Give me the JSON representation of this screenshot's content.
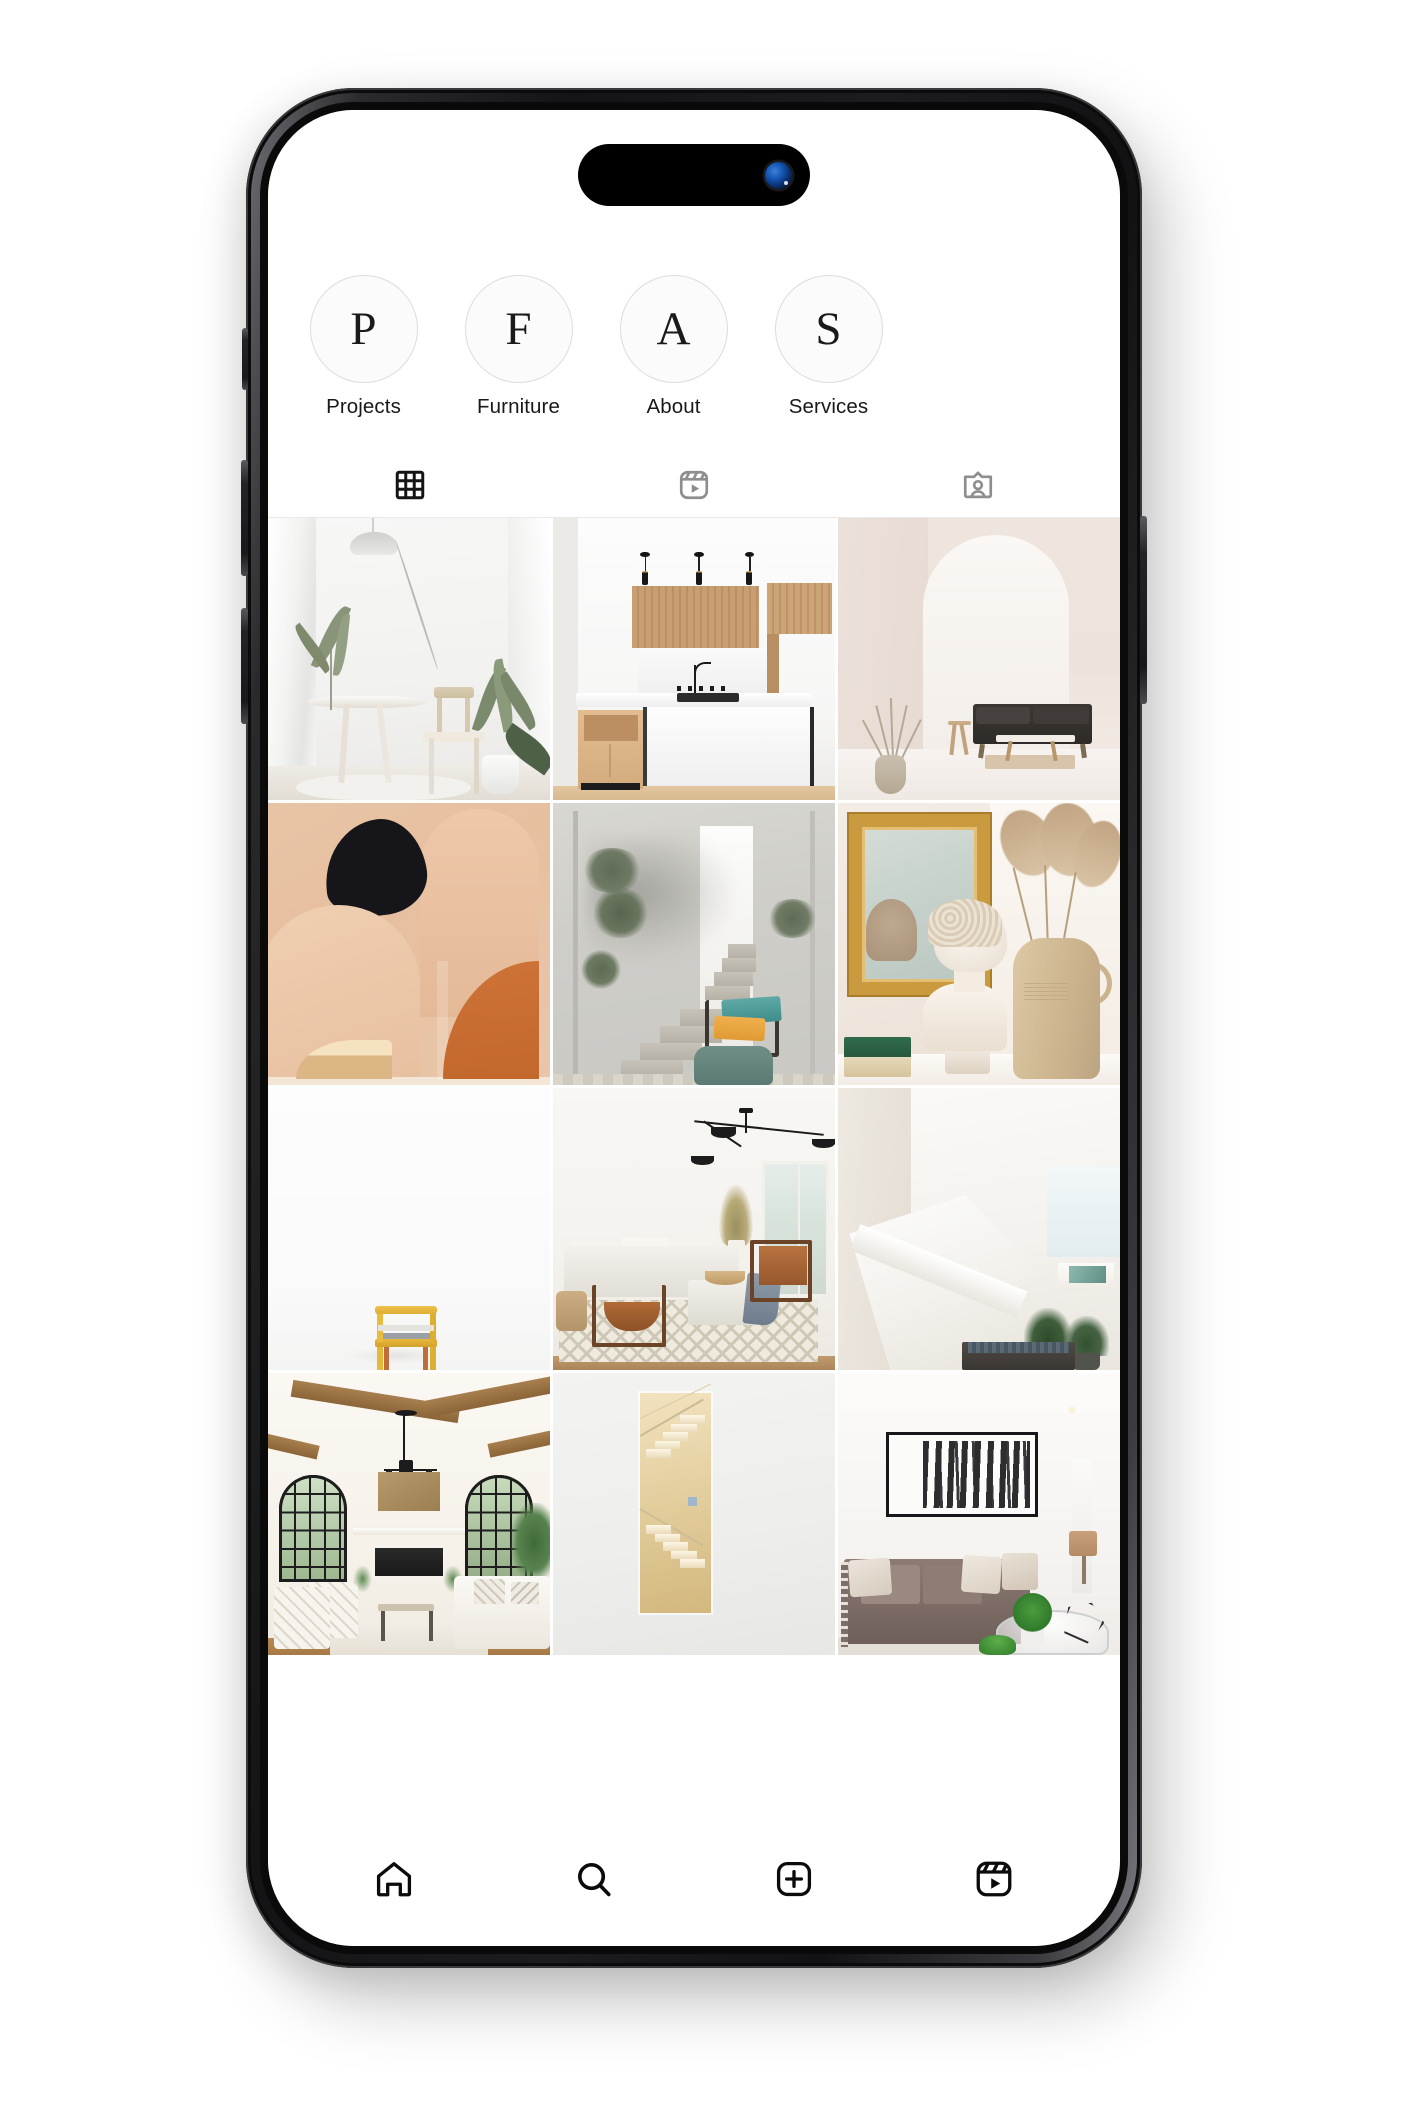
{
  "app": {
    "name": "instagram-profile",
    "device": "smartphone-mockup"
  },
  "status_bar": {
    "island_label": "Dynamic Island",
    "camera_icon": "camera-lens-icon"
  },
  "highlights": {
    "items": [
      {
        "letter": "P",
        "label": "Projects"
      },
      {
        "letter": "F",
        "label": "Furniture"
      },
      {
        "letter": "A",
        "label": "About"
      },
      {
        "letter": "S",
        "label": "Services"
      }
    ]
  },
  "profile_tabs": {
    "items": [
      {
        "icon": "grid-icon",
        "name": "posts-tab",
        "active": true
      },
      {
        "icon": "reels-icon",
        "name": "reels-tab",
        "active": false
      },
      {
        "icon": "tagged-icon",
        "name": "tagged-tab",
        "active": false
      }
    ],
    "active_color": "#141414",
    "inactive_color": "#8e8e8e"
  },
  "grid": {
    "columns": 3,
    "posts": [
      {
        "id": 1,
        "alt": "Bright white dining nook with round table, wooden chair and palm plants"
      },
      {
        "id": 2,
        "alt": "Modern kitchen with wood upper cabinets, white island and black pendant lights"
      },
      {
        "id": 3,
        "alt": "Beige arched room with dark sofa, low table and a vase of dried grass"
      },
      {
        "id": 4,
        "alt": "Abstract tan arch composition with black blob and terracotta quarter circle"
      },
      {
        "id": 5,
        "alt": "Grey staircase with olive tree shadows, teal and gold cushions on a green ottoman"
      },
      {
        "id": 6,
        "alt": "Plaster bust beside a gold mirror and ceramic jug with pampas grass"
      },
      {
        "id": 7,
        "alt": "Minimal white room with a small yellow wooden chair"
      },
      {
        "id": 8,
        "alt": "Airy living room with white sectional, leather sling chairs and geometric rug"
      },
      {
        "id": 9,
        "alt": "White staircase with under-stair bench and potted plants"
      },
      {
        "id": 10,
        "alt": "Living room with exposed wood beams, arched black windows and fireplace"
      },
      {
        "id": 11,
        "alt": "Gold framed wall panel showing a pale staircase"
      },
      {
        "id": 12,
        "alt": "Staged living room with brown sofa and black and white abstract art"
      }
    ]
  },
  "bottom_nav": {
    "items": [
      {
        "icon": "home-icon",
        "name": "nav-home"
      },
      {
        "icon": "search-icon",
        "name": "nav-search"
      },
      {
        "icon": "plus-icon",
        "name": "nav-create"
      },
      {
        "icon": "reels-icon",
        "name": "nav-reels"
      }
    ],
    "color": "#0b0b0b"
  },
  "device_buttons": {
    "items": [
      {
        "name": "mute-switch"
      },
      {
        "name": "volume-up-button"
      },
      {
        "name": "volume-down-button"
      },
      {
        "name": "power-button"
      }
    ]
  },
  "colors": {
    "background": "#ffffff",
    "frame": "#111113",
    "divider": "#e9e9e9",
    "text": "#19191b",
    "highlight_ring": "#dcdcdc"
  }
}
